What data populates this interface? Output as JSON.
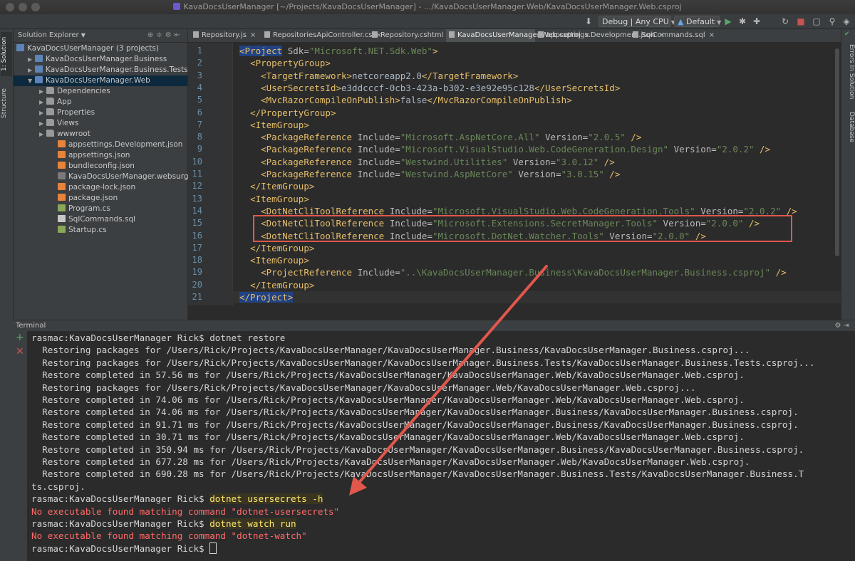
{
  "window": {
    "title": "KavaDocsUserManager [~/Projects/KavaDocsUserManager] - .../KavaDocsUserManager.Web/KavaDocsUserManager.Web.csproj"
  },
  "toolbar": {
    "config": "Debug | Any CPU",
    "target": "Default",
    "icons": [
      "build-icon",
      "run-icon",
      "debug-icon",
      "attach-icon",
      "refresh-icon",
      "stop-icon",
      "search-icon"
    ]
  },
  "left_strip": {
    "solution_tab": "1: Solution",
    "structure_tab": "Structure"
  },
  "right_strip": {
    "errors_tab": "Errors In Solution",
    "database_tab": "Database"
  },
  "solution_explorer": {
    "title": "Solution Explorer",
    "items": [
      {
        "label": "KavaDocsUserManager (3 projects)",
        "icon": "solution-icon",
        "depth": 0,
        "expanded": true
      },
      {
        "label": "KavaDocsUserManager.Business",
        "icon": "project-icon",
        "depth": 1,
        "expanded": false
      },
      {
        "label": "KavaDocsUserManager.Business.Tests",
        "icon": "project-icon",
        "depth": 1,
        "expanded": false
      },
      {
        "label": "KavaDocsUserManager.Web",
        "icon": "project-icon",
        "depth": 1,
        "expanded": true,
        "selected": true
      },
      {
        "label": "Dependencies",
        "icon": "dependencies-icon",
        "depth": 2,
        "expanded": false
      },
      {
        "label": "App",
        "icon": "folder-icon",
        "depth": 2,
        "expanded": false
      },
      {
        "label": "Properties",
        "icon": "folder-icon",
        "depth": 2,
        "expanded": false
      },
      {
        "label": "Views",
        "icon": "folder-icon",
        "depth": 2,
        "expanded": false
      },
      {
        "label": "wwwroot",
        "icon": "folder-icon",
        "depth": 2,
        "expanded": false
      },
      {
        "label": "appsettings.Development.json",
        "icon": "json-file-icon",
        "depth": 3
      },
      {
        "label": "appsettings.json",
        "icon": "json-file-icon",
        "depth": 3
      },
      {
        "label": "bundleconfig.json",
        "icon": "json-file-icon",
        "depth": 3
      },
      {
        "label": "KavaDocsUserManager.websurge",
        "icon": "file-icon",
        "depth": 3
      },
      {
        "label": "package-lock.json",
        "icon": "json-file-icon",
        "depth": 3
      },
      {
        "label": "package.json",
        "icon": "json-file-icon",
        "depth": 3
      },
      {
        "label": "Program.cs",
        "icon": "cs-file-icon",
        "depth": 3
      },
      {
        "label": "SqlCommands.sql",
        "icon": "sql-file-icon",
        "depth": 3
      },
      {
        "label": "Startup.cs",
        "icon": "cs-file-icon",
        "depth": 3
      }
    ]
  },
  "editor_tabs": [
    {
      "label": "Repository.js",
      "active": false
    },
    {
      "label": "RepositoriesApiController.cs",
      "active": false
    },
    {
      "label": "Repository.cshtml",
      "active": false
    },
    {
      "label": "KavaDocsUserManager.Web.csproj",
      "active": true
    },
    {
      "label": "appsettings.Development.json",
      "active": false
    },
    {
      "label": "SqlCommands.sql",
      "active": false
    }
  ],
  "code_lines": [
    {
      "n": "1",
      "indent": 0,
      "tag": "<Project",
      "attrs": [
        {
          "name": " Sdk=",
          "value": "\"Microsoft.NET.Sdk.Web\""
        }
      ],
      "close": ">",
      "text": ""
    },
    {
      "n": "2",
      "indent": 1,
      "tag": "<PropertyGroup",
      "attrs": [],
      "close": ">",
      "text": ""
    },
    {
      "n": "3",
      "indent": 2,
      "tag": "<TargetFramework>",
      "attrs": [],
      "close": "",
      "text": "netcoreapp2.0",
      "end": "</TargetFramework>"
    },
    {
      "n": "4",
      "indent": 2,
      "tag": "<UserSecretsId>",
      "attrs": [],
      "close": "",
      "text": "e3ddcccf-0cb3-423a-b302-e3e92e95c128",
      "end": "</UserSecretsId>"
    },
    {
      "n": "5",
      "indent": 2,
      "tag": "<MvcRazorCompileOnPublish>",
      "attrs": [],
      "close": "",
      "text": "false",
      "end": "</MvcRazorCompileOnPublish>"
    },
    {
      "n": "6",
      "indent": 1,
      "tag": "</PropertyGroup>",
      "attrs": [],
      "close": "",
      "text": ""
    },
    {
      "n": "7",
      "indent": 1,
      "tag": "<ItemGroup>",
      "attrs": [],
      "close": "",
      "text": ""
    },
    {
      "n": "8",
      "indent": 2,
      "tag": "<PackageReference",
      "attrs": [
        {
          "name": " Include=",
          "value": "\"Microsoft.AspNetCore.All\""
        },
        {
          "name": " Version=",
          "value": "\"2.0.5\""
        }
      ],
      "close": " />",
      "text": ""
    },
    {
      "n": "9",
      "indent": 2,
      "tag": "<PackageReference",
      "attrs": [
        {
          "name": " Include=",
          "value": "\"Microsoft.VisualStudio.Web.CodeGeneration.Design\""
        },
        {
          "name": " Version=",
          "value": "\"2.0.2\""
        }
      ],
      "close": " />",
      "text": ""
    },
    {
      "n": "10",
      "indent": 2,
      "tag": "<PackageReference",
      "attrs": [
        {
          "name": " Include=",
          "value": "\"Westwind.Utilities\""
        },
        {
          "name": " Version=",
          "value": "\"3.0.12\""
        }
      ],
      "close": " />",
      "text": ""
    },
    {
      "n": "11",
      "indent": 2,
      "tag": "<PackageReference",
      "attrs": [
        {
          "name": " Include=",
          "value": "\"Westwind.AspNetCore\""
        },
        {
          "name": " Version=",
          "value": "\"3.0.15\""
        }
      ],
      "close": " />",
      "text": ""
    },
    {
      "n": "12",
      "indent": 1,
      "tag": "</ItemGroup>",
      "attrs": [],
      "close": "",
      "text": ""
    },
    {
      "n": "13",
      "indent": 1,
      "tag": "<ItemGroup>",
      "attrs": [],
      "close": "",
      "text": ""
    },
    {
      "n": "14",
      "indent": 2,
      "tag": "<DotNetCliToolReference",
      "attrs": [
        {
          "name": " Include=",
          "value": "\"Microsoft.VisualStudio.Web.CodeGeneration.Tools\""
        },
        {
          "name": " Version=",
          "value": "\"2.0.2\""
        }
      ],
      "close": " />",
      "text": ""
    },
    {
      "n": "15",
      "indent": 2,
      "tag": "<DotNetCliToolReference",
      "attrs": [
        {
          "name": " Include=",
          "value": "\"Microsoft.Extensions.SecretManager.Tools\""
        },
        {
          "name": " Version=",
          "value": "\"2.0.0\""
        }
      ],
      "close": " />",
      "text": ""
    },
    {
      "n": "16",
      "indent": 2,
      "tag": "<DotNetCliToolReference",
      "attrs": [
        {
          "name": " Include=",
          "value": "\"Microsoft.DotNet.Watcher.Tools\""
        },
        {
          "name": " Version=",
          "value": "\"2.0.0\""
        }
      ],
      "close": " />",
      "text": ""
    },
    {
      "n": "17",
      "indent": 1,
      "tag": "</ItemGroup>",
      "attrs": [],
      "close": "",
      "text": ""
    },
    {
      "n": "18",
      "indent": 1,
      "tag": "<ItemGroup>",
      "attrs": [],
      "close": "",
      "text": ""
    },
    {
      "n": "19",
      "indent": 2,
      "tag": "<ProjectReference",
      "attrs": [
        {
          "name": " Include=",
          "value": "\"..\\KavaDocsUserManager.Business\\KavaDocsUserManager.Business.csproj\""
        }
      ],
      "close": " />",
      "text": ""
    },
    {
      "n": "20",
      "indent": 1,
      "tag": "</ItemGroup>",
      "attrs": [],
      "close": "",
      "text": ""
    },
    {
      "n": "21",
      "indent": 0,
      "tag": "</Project>",
      "attrs": [],
      "close": "",
      "text": "",
      "current": true
    }
  ],
  "terminal": {
    "title": "Terminal",
    "lines": [
      {
        "text": "rasmac:KavaDocsUserManager Rick$ dotnet restore",
        "kind": "normal"
      },
      {
        "text": "  Restoring packages for /Users/Rick/Projects/KavaDocsUserManager/KavaDocsUserManager.Business/KavaDocsUserManager.Business.csproj...",
        "kind": "normal"
      },
      {
        "text": "  Restoring packages for /Users/Rick/Projects/KavaDocsUserManager/KavaDocsUserManager.Business.Tests/KavaDocsUserManager.Business.Tests.csproj...",
        "kind": "normal"
      },
      {
        "text": "  Restore completed in 57.56 ms for /Users/Rick/Projects/KavaDocsUserManager/KavaDocsUserManager.Web/KavaDocsUserManager.Web.csproj.",
        "kind": "normal"
      },
      {
        "text": "  Restoring packages for /Users/Rick/Projects/KavaDocsUserManager/KavaDocsUserManager.Web/KavaDocsUserManager.Web.csproj...",
        "kind": "normal"
      },
      {
        "text": "  Restore completed in 74.06 ms for /Users/Rick/Projects/KavaDocsUserManager/KavaDocsUserManager.Web/KavaDocsUserManager.Web.csproj.",
        "kind": "normal"
      },
      {
        "text": "  Restore completed in 74.06 ms for /Users/Rick/Projects/KavaDocsUserManager/KavaDocsUserManager.Business/KavaDocsUserManager.Business.csproj.",
        "kind": "normal"
      },
      {
        "text": "  Restore completed in 91.71 ms for /Users/Rick/Projects/KavaDocsUserManager/KavaDocsUserManager.Business/KavaDocsUserManager.Business.csproj.",
        "kind": "normal"
      },
      {
        "text": "  Restore completed in 30.71 ms for /Users/Rick/Projects/KavaDocsUserManager/KavaDocsUserManager.Web/KavaDocsUserManager.Web.csproj.",
        "kind": "normal"
      },
      {
        "text": "  Restore completed in 350.94 ms for /Users/Rick/Projects/KavaDocsUserManager/KavaDocsUserManager.Business/KavaDocsUserManager.Business.csproj.",
        "kind": "normal"
      },
      {
        "text": "  Restore completed in 677.28 ms for /Users/Rick/Projects/KavaDocsUserManager/KavaDocsUserManager.Web/KavaDocsUserManager.Web.csproj.",
        "kind": "normal"
      },
      {
        "text": "  Restore completed in 690.28 ms for /Users/Rick/Projects/KavaDocsUserManager/KavaDocsUserManager.Business.Tests/KavaDocsUserManager.Business.T",
        "kind": "normal"
      },
      {
        "text": "ts.csproj.",
        "kind": "normal"
      },
      {
        "text": "rasmac:KavaDocsUserManager Rick$ ",
        "cmd": "dotnet usersecrets -h",
        "kind": "prompt"
      },
      {
        "text": "No executable found matching command \"dotnet-usersecrets\"",
        "kind": "err"
      },
      {
        "text": "rasmac:KavaDocsUserManager Rick$ ",
        "cmd": "dotnet watch run",
        "kind": "prompt"
      },
      {
        "text": "No executable found matching command \"dotnet-watch\"",
        "kind": "err"
      },
      {
        "text": "rasmac:KavaDocsUserManager Rick$ ",
        "kind": "cursor"
      }
    ]
  },
  "colors": {
    "annotation": "#e2574c",
    "selection": "#0d293e",
    "tag": "#e8bf6a",
    "value": "#6a8759",
    "error": "#ff6b68"
  }
}
